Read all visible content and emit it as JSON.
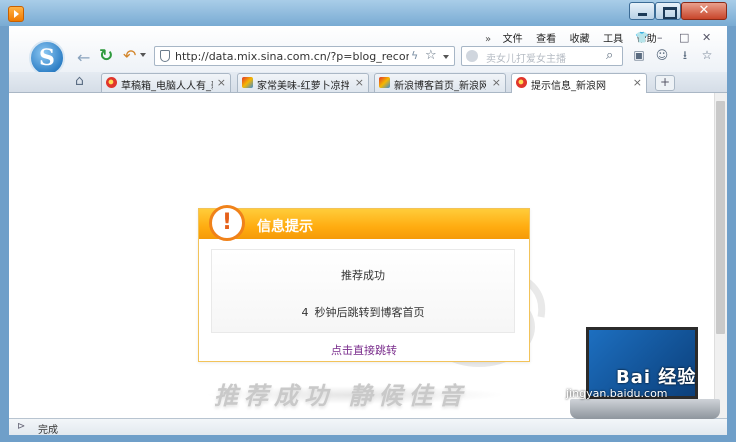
{
  "menu": {
    "chevron": "»",
    "items": [
      "文件",
      "查看",
      "收藏",
      "工具",
      "帮助"
    ]
  },
  "address_bar": {
    "url": "http://data.mix.sina.com.cn/?p=blog_recommer"
  },
  "search": {
    "placeholder": "卖女儿打爱女主播"
  },
  "tabs": [
    {
      "title": "草稿箱_电脑人人有_新浪",
      "active": false
    },
    {
      "title": "家常美味-红萝卜凉拌黄瓜",
      "active": false
    },
    {
      "title": "新浪博客首页_新浪网",
      "active": false
    },
    {
      "title": "提示信息_新浪网",
      "active": true
    }
  ],
  "dialog": {
    "title": "信息提示",
    "message": "推荐成功",
    "countdown_number": "4",
    "countdown_text": "秒钟后跳转到博客首页",
    "link": "点击直接跳转"
  },
  "watermark_text": "推荐成功 静候佳音",
  "status": {
    "text": "完成"
  },
  "corner_watermark": {
    "line1": "Bai 经验",
    "line2": "jingyan.baidu.com"
  },
  "colors": {
    "dialog_header": "#ffac10",
    "alert_ring": "#f0821a",
    "link": "#7a2d8c",
    "window_frame": "#6f9fc9"
  },
  "icons": [
    "app-icon",
    "logo-icon",
    "back-icon",
    "refresh-icon",
    "undo-icon",
    "shield-icon",
    "bolt-icon",
    "star-icon",
    "search-icon",
    "home-icon",
    "alert-icon",
    "download-icon"
  ]
}
